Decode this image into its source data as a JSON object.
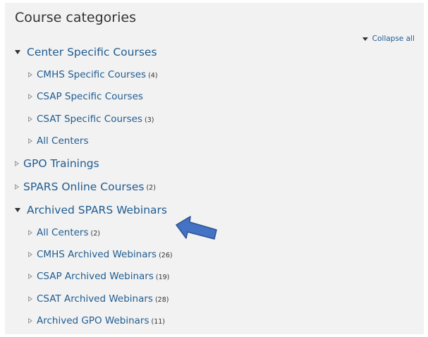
{
  "header": {
    "title": "Course categories",
    "collapse_all_label": "Collapse all"
  },
  "categories": [
    {
      "label": "Center Specific Courses",
      "count": "",
      "expanded": true,
      "children": [
        {
          "label": "CMHS Specific Courses",
          "count": "(4)"
        },
        {
          "label": "CSAP Specific Courses",
          "count": ""
        },
        {
          "label": "CSAT Specific Courses",
          "count": "(3)"
        },
        {
          "label": "All Centers",
          "count": ""
        }
      ]
    },
    {
      "label": "GPO Trainings",
      "count": "",
      "expanded": false,
      "children": []
    },
    {
      "label": "SPARS Online Courses",
      "count": "(2)",
      "expanded": false,
      "children": []
    },
    {
      "label": "Archived SPARS Webinars",
      "count": "",
      "expanded": true,
      "children": [
        {
          "label": "All Centers",
          "count": "(2)"
        },
        {
          "label": "CMHS Archived Webinars",
          "count": "(26)"
        },
        {
          "label": "CSAP Archived Webinars",
          "count": "(19)"
        },
        {
          "label": "CSAT Archived Webinars",
          "count": "(28)"
        },
        {
          "label": "Archived GPO Webinars",
          "count": "(11)"
        }
      ]
    }
  ],
  "colors": {
    "link": "#1f5c91",
    "panel_bg": "#f2f2f2",
    "annotation_arrow": "#4472c4"
  },
  "icons": {
    "expanded": "triangle-down-icon",
    "collapsed": "triangle-right-icon",
    "annotation": "arrow-left-icon"
  }
}
